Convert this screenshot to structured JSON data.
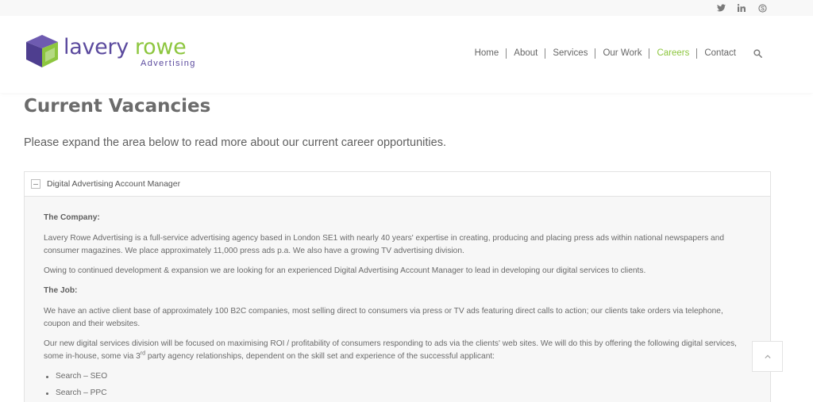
{
  "social": [
    {
      "name": "twitter-icon"
    },
    {
      "name": "linkedin-icon"
    },
    {
      "name": "skype-icon"
    }
  ],
  "logo": {
    "word1": "lavery",
    "word2": "rowe",
    "sub": "Advertising"
  },
  "nav": {
    "items": [
      "Home",
      "About",
      "Services",
      "Our Work",
      "Careers",
      "Contact"
    ],
    "active": "Careers",
    "search_icon": "search-icon"
  },
  "page": {
    "title": "Current Vacancies",
    "intro": "Please expand the area below to read more about our current career opportunities."
  },
  "accordion": {
    "header": "Digital Advertising Account Manager",
    "company_heading": "The Company:",
    "company_p1": "Lavery Rowe Advertising is a full-service advertising agency based in London SE1 with nearly 40 years' expertise in creating, producing and placing press ads within national newspapers and consumer magazines. We place approximately 11,000 press ads p.a. We also have a growing TV advertising division.",
    "company_p2": "Owing to continued development & expansion we are looking for an experienced Digital Advertising Account Manager to lead in developing our digital services to clients.",
    "job_heading": "The Job:",
    "job_p1": "We have an active client base of approximately 100 B2C companies, most selling direct to consumers via press or TV ads featuring direct calls to action; our clients take orders via telephone, coupon and their websites.",
    "job_p2_a": "Our new digital services division will be focused on maximising ROI / profitability of consumers responding to ads via the clients' web sites. We will do this by offering the following digital services, some in-house, some via 3",
    "job_p2_sup": "rd",
    "job_p2_b": " party agency relationships, dependent on the skill set and experience of the successful applicant:",
    "services": [
      "Search – SEO",
      "Search – PPC"
    ]
  },
  "colors": {
    "brand_purple": "#5b4a9e",
    "brand_green": "#8dc63f"
  }
}
